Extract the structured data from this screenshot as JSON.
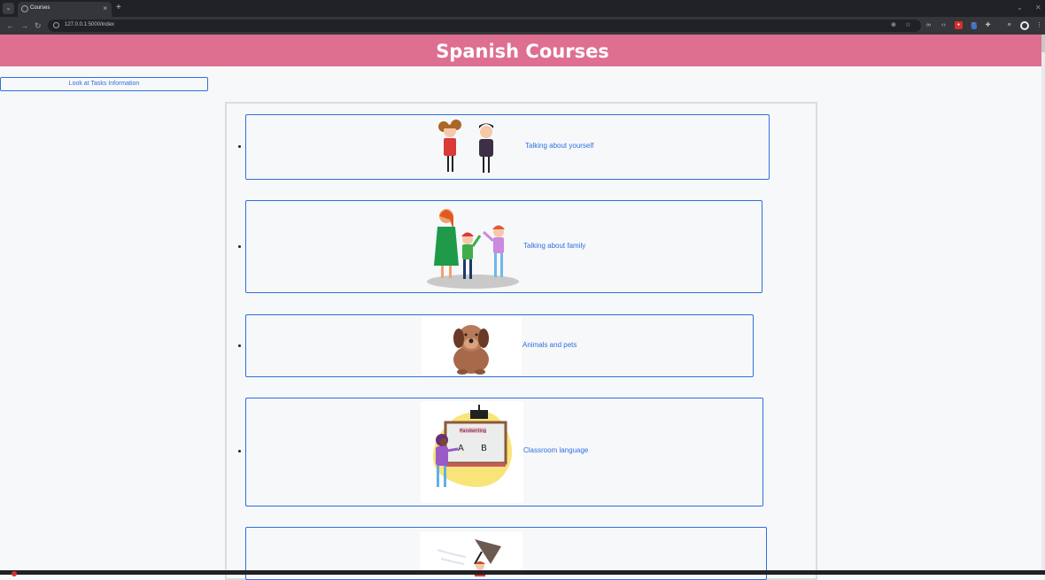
{
  "browser": {
    "tab": {
      "title": "Courses",
      "close": "×"
    },
    "new_tab": "+",
    "url": "127.0.0.1:5000/index",
    "controls": {
      "back": "←",
      "forward": "→",
      "reload": "↻",
      "minimize": "⌄",
      "close": "✕"
    },
    "icons": {
      "tab_list": "chevron-down-icon",
      "zoom": "zoom-icon",
      "bookmark": "star-icon",
      "extensions": "puzzle-icon",
      "profile": "profile-icon"
    }
  },
  "page": {
    "title": "Spanish Courses",
    "info_button": "Look at Tasks Information",
    "courses": [
      {
        "label": "Talking about yourself",
        "image": "boy-and-girl-illustration"
      },
      {
        "label": "Talking about family",
        "image": "family-illustration"
      },
      {
        "label": "Animals and pets",
        "image": "dog-illustration"
      },
      {
        "label": "Classroom language",
        "image": "classroom-whiteboard-illustration",
        "board_title": "Handwriting",
        "board_letters": [
          "A",
          "B"
        ]
      },
      {
        "label": "",
        "image": "windy-umbrella-illustration"
      }
    ]
  },
  "colors": {
    "header": "#de6f90",
    "accent": "#2f6fe0",
    "page_background": "#f7f8fa"
  }
}
